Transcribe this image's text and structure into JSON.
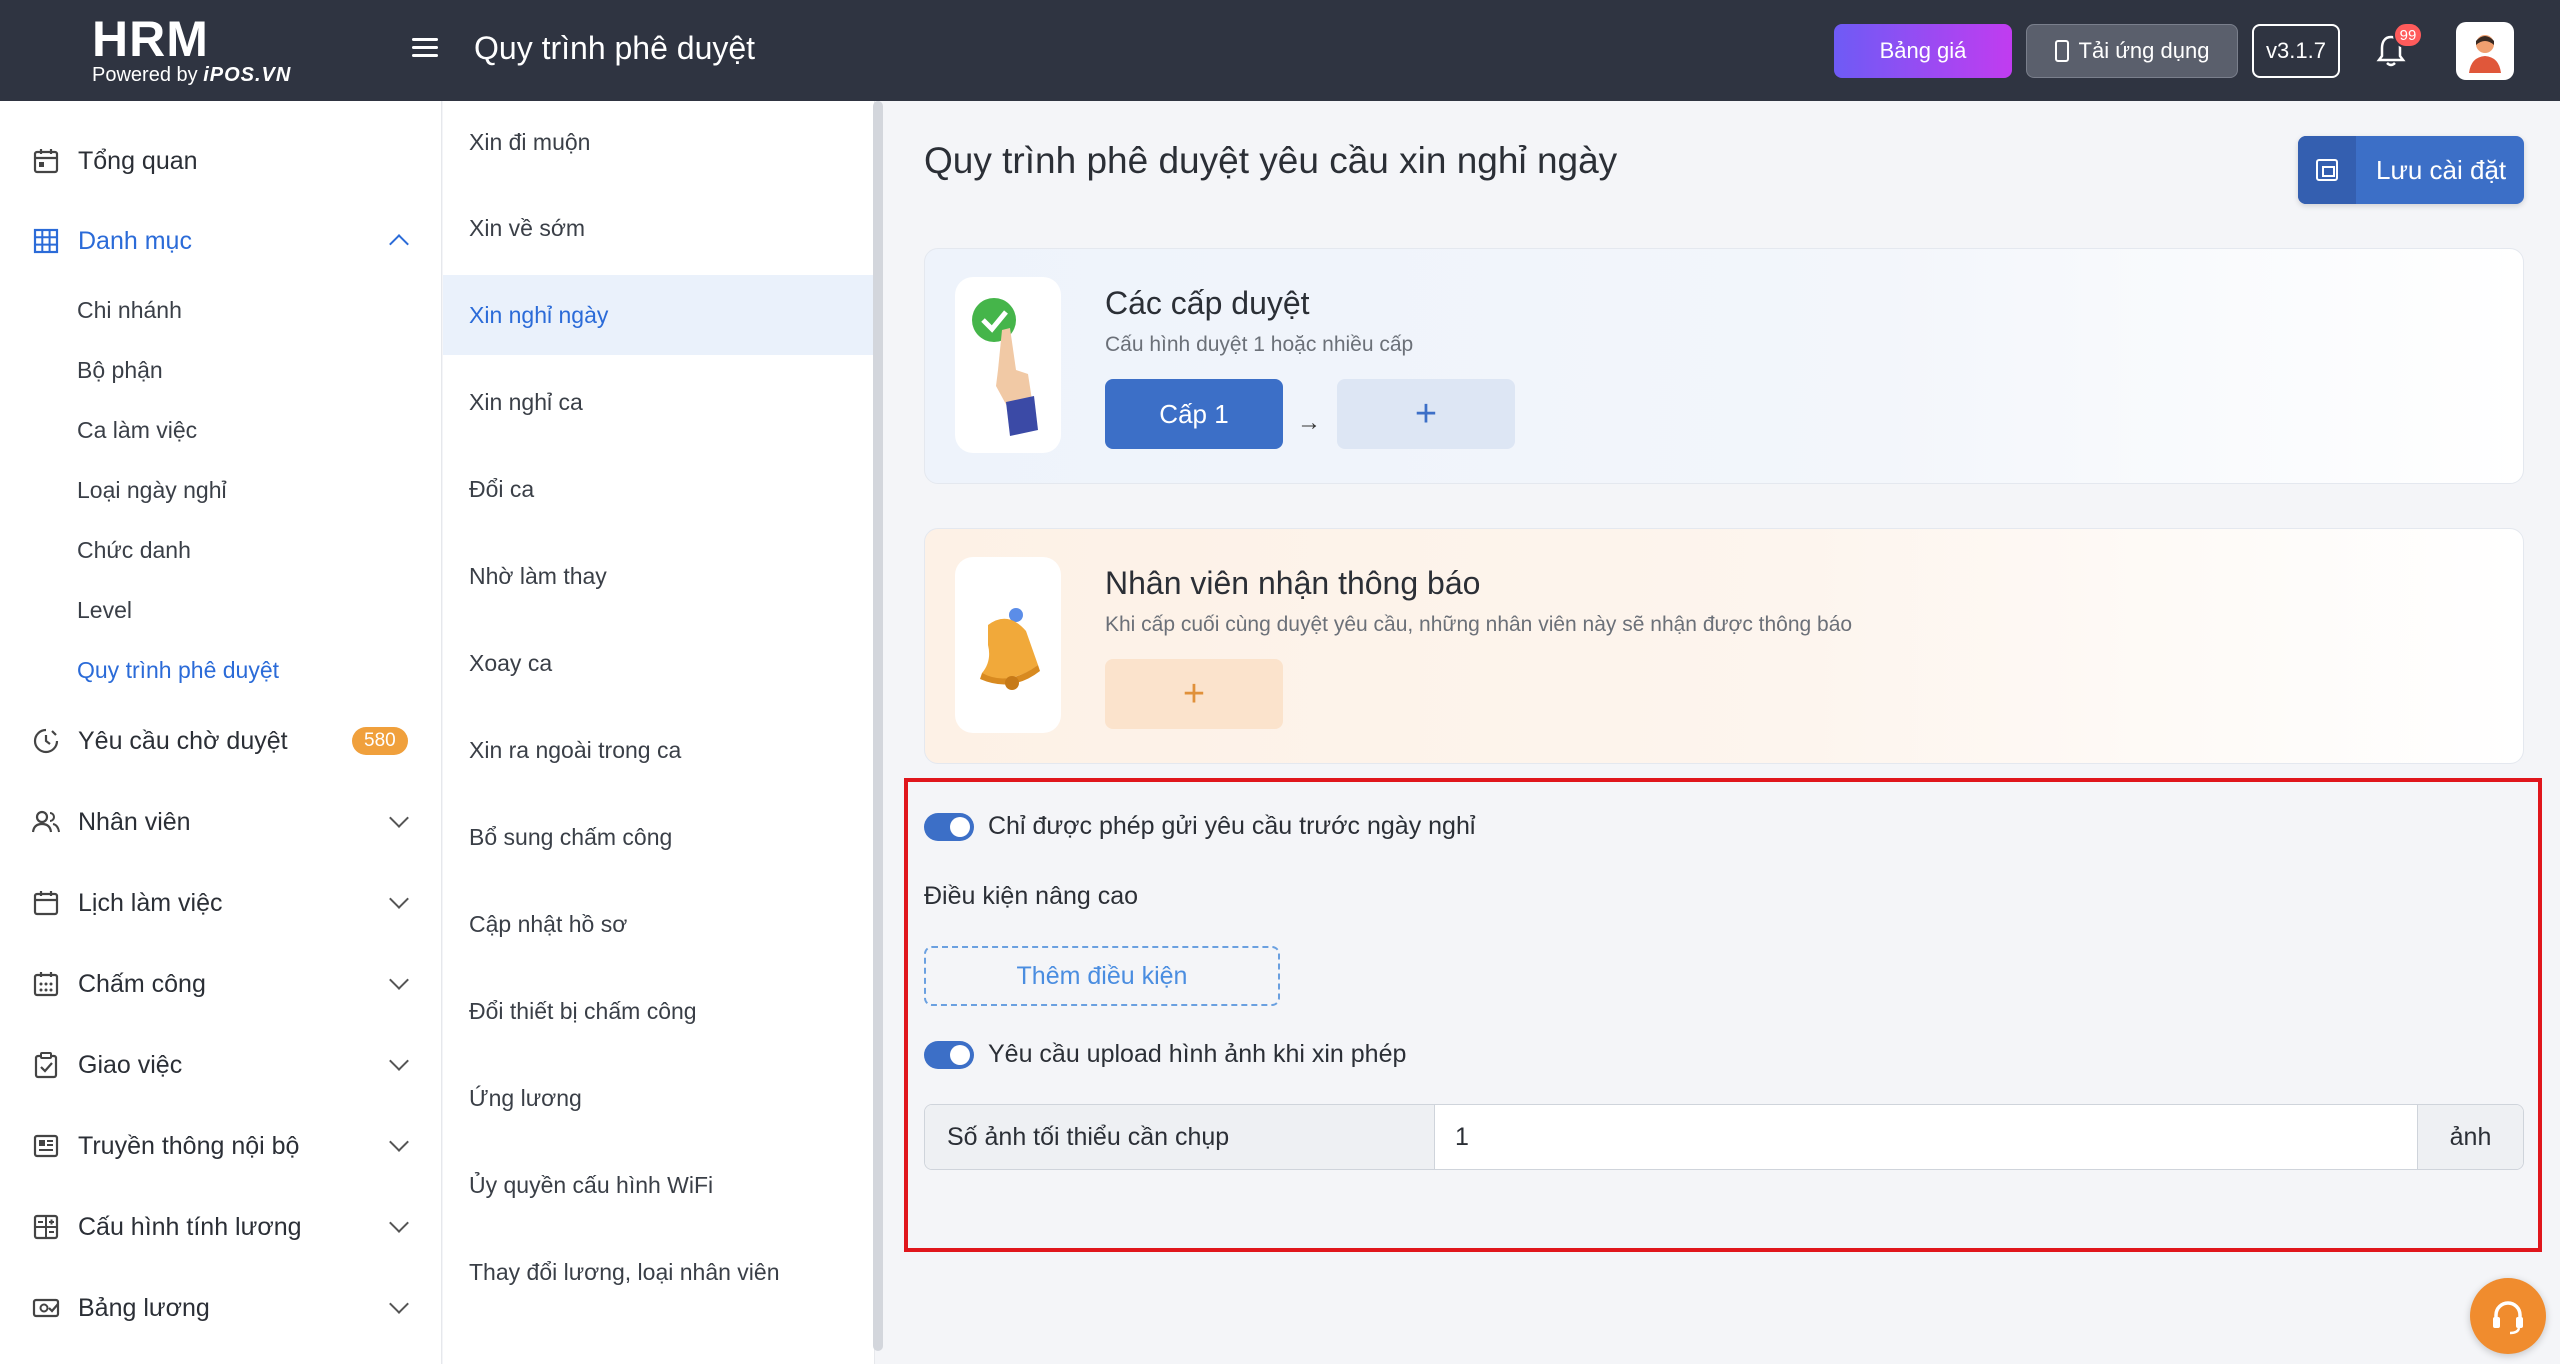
{
  "header": {
    "logo_main": "HRM",
    "logo_powered": "Powered by",
    "logo_brand": "iPOS.VN",
    "title": "Quy trình phê duyệt",
    "pricing_label": "Bảng giá",
    "app_label": "Tải ứng dụng",
    "version_label": "v3.1.7",
    "notification_count": "99"
  },
  "sidebar": {
    "items": [
      {
        "label": "Tổng quan"
      },
      {
        "label": "Danh mục"
      },
      {
        "label": "Yêu cầu chờ duyệt",
        "badge": "580"
      },
      {
        "label": "Nhân viên"
      },
      {
        "label": "Lịch làm việc"
      },
      {
        "label": "Chấm công"
      },
      {
        "label": "Giao việc"
      },
      {
        "label": "Truyền thông nội bộ"
      },
      {
        "label": "Cấu hình tính lương"
      },
      {
        "label": "Bảng lương"
      }
    ],
    "subitems": [
      {
        "label": "Chi nhánh"
      },
      {
        "label": "Bộ phận"
      },
      {
        "label": "Ca làm việc"
      },
      {
        "label": "Loại ngày nghỉ"
      },
      {
        "label": "Chức danh"
      },
      {
        "label": "Level"
      },
      {
        "label": "Quy trình phê duyệt"
      }
    ]
  },
  "request_types": [
    {
      "label": "Xin đi muộn"
    },
    {
      "label": "Xin về sớm"
    },
    {
      "label": "Xin nghỉ ngày"
    },
    {
      "label": "Xin nghỉ ca"
    },
    {
      "label": "Đổi ca"
    },
    {
      "label": "Nhờ làm thay"
    },
    {
      "label": "Xoay ca"
    },
    {
      "label": "Xin ra ngoài trong ca"
    },
    {
      "label": "Bổ sung chấm công"
    },
    {
      "label": "Cập nhật hồ sơ"
    },
    {
      "label": "Đổi thiết bị chấm công"
    },
    {
      "label": "Ứng lương"
    },
    {
      "label": "Ủy quyền cấu hình WiFi"
    },
    {
      "label": "Thay đổi lương, loại nhân viên"
    }
  ],
  "main": {
    "title": "Quy trình phê duyệt yêu cầu xin nghỉ ngày",
    "save_label": "Lưu cài đặt",
    "levels_card": {
      "title": "Các cấp duyệt",
      "subtitle": "Cấu hình duyệt 1 hoặc nhiều cấp",
      "level_label": "Cấp 1",
      "add_symbol": "+"
    },
    "notify_card": {
      "title": "Nhân viên nhận thông báo",
      "subtitle": "Khi cấp cuối cùng duyệt yêu cầu, những nhân viên này sẽ nhận được thông báo",
      "add_symbol": "+"
    },
    "toggle_before_leave": "Chỉ được phép gửi yêu cầu trước ngày nghỉ",
    "advanced_label": "Điều kiện nâng cao",
    "add_condition_label": "Thêm điều kiện",
    "toggle_upload": "Yêu cầu upload hình ảnh khi xin phép",
    "min_photos_label": "Số ảnh tối thiểu cần chụp",
    "min_photos_value": "1",
    "min_photos_unit": "ảnh"
  },
  "colors": {
    "accent": "#3c6fc7",
    "topbar": "#2f3441",
    "highlight_border": "#e0161c",
    "badge": "#f0a03c",
    "support": "#f08c2e"
  }
}
